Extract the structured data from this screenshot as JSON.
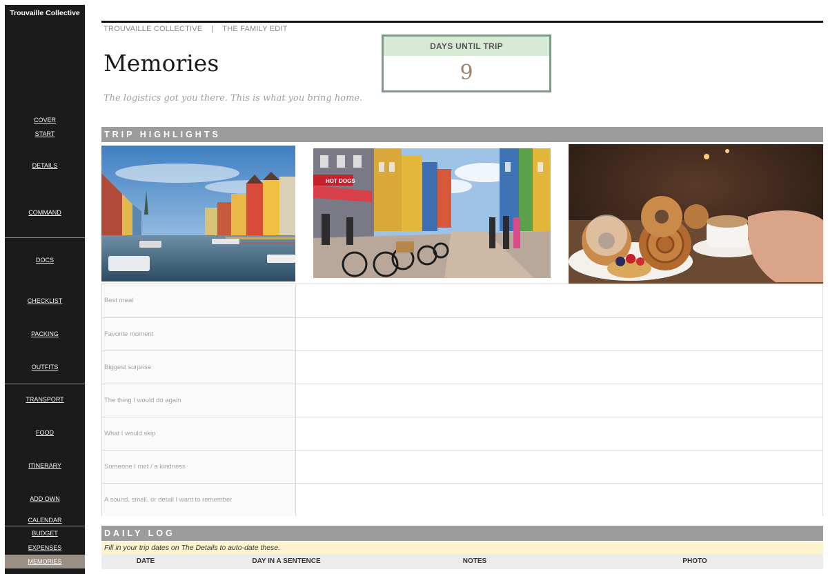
{
  "sidebar": {
    "brand": "Trouvaille Collective",
    "items": [
      {
        "label": "COVER"
      },
      {
        "label": "START"
      },
      {
        "label": "DETAILS"
      },
      {
        "label": "COMMAND"
      },
      {
        "label": "DOCS"
      },
      {
        "label": "CHECKLIST"
      },
      {
        "label": "PACKING"
      },
      {
        "label": "OUTFITS"
      },
      {
        "label": "TRANSPORT"
      },
      {
        "label": "FOOD"
      },
      {
        "label": "ITINERARY"
      },
      {
        "label": "ADD OWN"
      },
      {
        "label": "CALENDAR"
      },
      {
        "label": "BUDGET"
      },
      {
        "label": "EXPENSES"
      },
      {
        "label": "MEMORIES"
      }
    ],
    "active": "MEMORIES"
  },
  "header": {
    "breadcrumb": "TROUVAILLE COLLECTIVE    |    THE FAMILY EDIT",
    "title": "Memories",
    "tagline": "The logistics got you there. This is what you bring home."
  },
  "countdown": {
    "label": "DAYS UNTIL TRIP",
    "value": "9"
  },
  "highlights": {
    "section_title": "TRIP HIGHLIGHTS",
    "prompts": [
      {
        "label": "Best meal",
        "value": ""
      },
      {
        "label": "Favorite moment",
        "value": ""
      },
      {
        "label": "Biggest surprise",
        "value": ""
      },
      {
        "label": "The thing I would do again",
        "value": ""
      },
      {
        "label": "What I would skip",
        "value": ""
      },
      {
        "label": "Someone I met / a kindness",
        "value": ""
      },
      {
        "label": "A sound, smell, or detail I want to remember",
        "value": ""
      }
    ]
  },
  "photos": {
    "shop_sign": "HOT DOGS"
  },
  "daily_log": {
    "section_title": "DAILY LOG",
    "note": "Fill in your trip dates on The Details to auto-date these.",
    "columns": [
      "DATE",
      "DAY IN A SENTENCE",
      "NOTES",
      "PHOTO"
    ]
  },
  "colors": {
    "sidebar_bg": "#1b1b1b",
    "active_item": "#9a8f84",
    "section_bar": "#9c9c9c",
    "countdown_border": "#7f9a86",
    "countdown_label_bg": "#d7ead6",
    "log_note_bg": "#fdf3cd"
  }
}
